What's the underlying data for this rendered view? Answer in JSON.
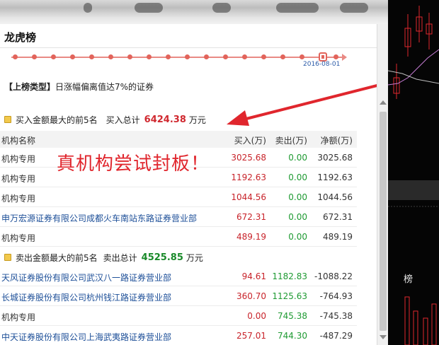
{
  "panel": {
    "title": "龙虎榜",
    "date": "2016-08-01",
    "type_label": "【上榜类型】",
    "type_text": "日涨幅偏离值达7%的证券"
  },
  "buy_section": {
    "label": "买入金额最大的前5名",
    "total_label": "买入总计",
    "total_value": "6424.38",
    "unit": "万元"
  },
  "sell_section": {
    "label": "卖出金额最大的前5名",
    "total_label": "卖出总计",
    "total_value": "4525.85",
    "unit": "万元"
  },
  "columns": {
    "name": "机构名称",
    "buy": "买入(万)",
    "sell": "卖出(万)",
    "net": "净额(万)"
  },
  "buy_rows": [
    {
      "name": "机构专用",
      "buy": "3025.68",
      "sell": "0.00",
      "net": "3025.68"
    },
    {
      "name": "机构专用",
      "buy": "1192.63",
      "sell": "0.00",
      "net": "1192.63"
    },
    {
      "name": "机构专用",
      "buy": "1044.56",
      "sell": "0.00",
      "net": "1044.56"
    },
    {
      "name": "申万宏源证券有限公司成都火车南站东路证券营业部",
      "buy": "672.31",
      "sell": "0.00",
      "net": "672.31"
    },
    {
      "name": "机构专用",
      "buy": "489.19",
      "sell": "0.00",
      "net": "489.19"
    }
  ],
  "sell_rows": [
    {
      "name": "天风证券股份有限公司武汉八一路证券营业部",
      "buy": "94.61",
      "sell": "1182.83",
      "net": "-1088.22"
    },
    {
      "name": "长城证券股份有限公司杭州钱江路证券营业部",
      "buy": "360.70",
      "sell": "1125.63",
      "net": "-764.93"
    },
    {
      "name": "机构专用",
      "buy": "0.00",
      "sell": "745.38",
      "net": "-745.38"
    },
    {
      "name": "中天证券股份有限公司上海武夷路证券营业部",
      "buy": "257.01",
      "sell": "744.30",
      "net": "-487.29"
    }
  ],
  "annotation": "真机构尝试封板！",
  "side_chart": {
    "label": "榜"
  },
  "colors": {
    "accent_red": "#d0282f",
    "green": "#1a8a2a",
    "link_blue": "#1d4f98"
  }
}
